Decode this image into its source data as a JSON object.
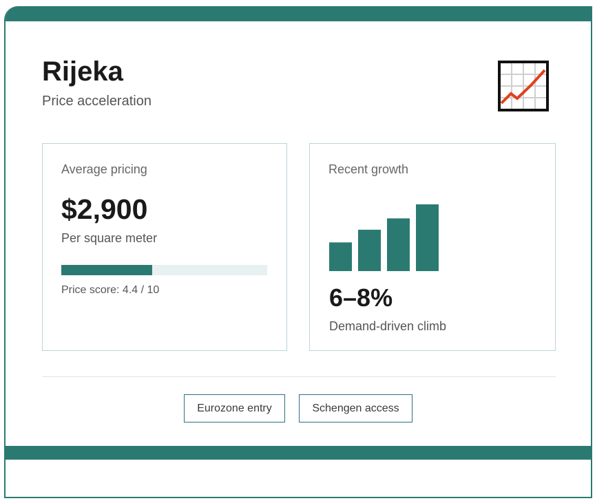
{
  "header": {
    "title": "Rijeka",
    "subtitle": "Price acceleration",
    "icon": "chart-increasing-icon"
  },
  "pricing": {
    "label": "Average pricing",
    "value": "$2,900",
    "unit": "Per square meter",
    "score_text": "Price score: 4.4 / 10",
    "score": 4.4,
    "score_max": 10
  },
  "growth": {
    "label": "Recent growth",
    "value": "6–8%",
    "description": "Demand-driven climb",
    "bar_levels": [
      0.43,
      0.62,
      0.79,
      1.0
    ]
  },
  "tags": [
    {
      "label": "Eurozone entry"
    },
    {
      "label": "Schengen access"
    }
  ],
  "colors": {
    "accent": "#2b7a72",
    "track": "#e8f1f1",
    "panel_border": "#b9d6d8",
    "icon_line": "#e0401d"
  }
}
